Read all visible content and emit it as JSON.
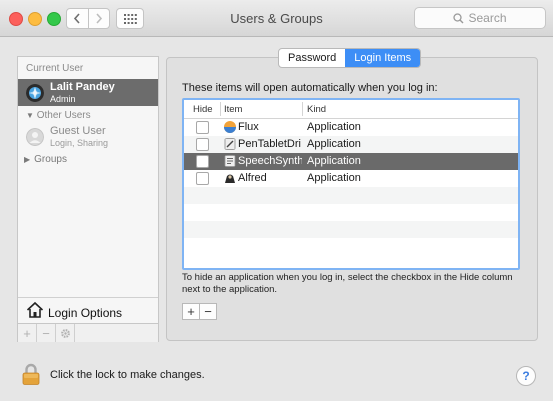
{
  "window": {
    "title": "Users & Groups",
    "search_placeholder": "Search"
  },
  "sidebar": {
    "current_user_header": "Current User",
    "current_user": {
      "name": "Lalit Pandey",
      "role": "Admin"
    },
    "other_users_header": "Other Users",
    "guest_user": {
      "name": "Guest User",
      "detail": "Login, Sharing"
    },
    "groups_label": "Groups",
    "login_options_label": "Login Options",
    "footer": {
      "add": "+",
      "remove": "−",
      "action": "✲"
    }
  },
  "tabs": [
    {
      "label": "Password",
      "active": false
    },
    {
      "label": "Login Items",
      "active": true
    }
  ],
  "login_items": {
    "intro": "These items will open automatically when you log in:",
    "columns": {
      "hide": "Hide",
      "item": "Item",
      "kind": "Kind"
    },
    "rows": [
      {
        "name": "Flux",
        "kind": "Application",
        "hide": false,
        "selected": false,
        "icon": "flux-icon"
      },
      {
        "name": "PenTabletDri",
        "kind": "Application",
        "hide": false,
        "selected": false,
        "icon": "pentablet-icon"
      },
      {
        "name": "SpeechSynth",
        "kind": "Application",
        "hide": false,
        "selected": true,
        "icon": "speechsynth-icon"
      },
      {
        "name": "Alfred",
        "kind": "Application",
        "hide": false,
        "selected": false,
        "icon": "alfred-icon"
      }
    ],
    "hint": "To hide an application when you log in, select the checkbox in the Hide column next to the application.",
    "add_label": "+",
    "remove_label": "−"
  },
  "footer": {
    "lock_text": "Click the lock to make changes.",
    "help_label": "?"
  },
  "colors": {
    "accent": "#3d8ef6",
    "selection": "#6a6a6a",
    "table_focus": "#7fb4f4"
  }
}
